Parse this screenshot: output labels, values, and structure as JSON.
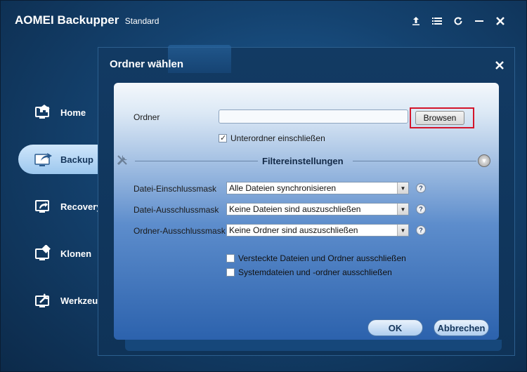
{
  "app": {
    "name": "AOMEI Backupper",
    "edition": "Standard"
  },
  "window_controls": [
    "upgrade-icon",
    "menu-icon",
    "refresh-icon",
    "minimize-icon",
    "close-icon"
  ],
  "sidebar": {
    "items": [
      {
        "label": "Home",
        "icon": "home-icon",
        "active": false
      },
      {
        "label": "Backup",
        "icon": "backup-icon",
        "active": true
      },
      {
        "label": "Recovery",
        "icon": "recovery-icon",
        "active": false
      },
      {
        "label": "Klonen",
        "icon": "clone-icon",
        "active": false
      },
      {
        "label": "Werkzeuge",
        "icon": "tools-icon",
        "active": false
      }
    ]
  },
  "dialog": {
    "title": "Ordner wählen",
    "folder_label": "Ordner",
    "folder_value": "",
    "browse_label": "Browsen",
    "include_subfolders_label": "Unterordner einschließen",
    "include_subfolders_checked": true,
    "filter_title": "Filtereinstellungen",
    "filters": [
      {
        "label": "Datei-Einschlussmask",
        "value": "Alle Dateien synchronisieren"
      },
      {
        "label": "Datei-Ausschlussmask",
        "value": "Keine Dateien sind auszuschließen"
      },
      {
        "label": "Ordner-Ausschlussmask",
        "value": "Keine Ordner sind auszuschließen"
      }
    ],
    "exclude_hidden_label": "Versteckte Dateien und Ordner ausschließen",
    "exclude_hidden_checked": false,
    "exclude_system_label": "Systemdateien und -ordner ausschließen",
    "exclude_system_checked": false,
    "ok_label": "OK",
    "cancel_label": "Abbrechen"
  },
  "colors": {
    "highlight": "#d4142a",
    "accent": "#2c62ad"
  }
}
